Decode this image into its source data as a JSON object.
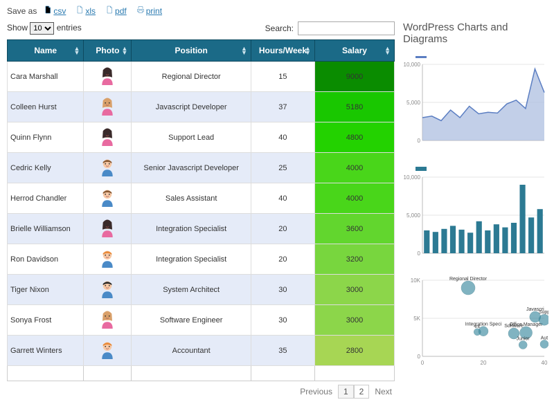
{
  "export": {
    "save_as": "Save as",
    "csv": "csv",
    "xls": "xls",
    "pdf": "pdf",
    "print": "print"
  },
  "controls": {
    "show": "Show",
    "entries": "entries",
    "per_page": "10",
    "search_label": "Search:",
    "search_value": ""
  },
  "columns": {
    "name": "Name",
    "photo": "Photo",
    "position": "Position",
    "hours": "Hours/Week",
    "salary": "Salary"
  },
  "rows": [
    {
      "name": "Cara Marshall",
      "position": "Regional Director",
      "hours": "15",
      "salary": "9000",
      "avatar": "f-dark",
      "sal_color": "#0a8c00"
    },
    {
      "name": "Colleen Hurst",
      "position": "Javascript Developer",
      "hours": "37",
      "salary": "5180",
      "avatar": "f-tan",
      "sal_color": "#19c700"
    },
    {
      "name": "Quinn Flynn",
      "position": "Support Lead",
      "hours": "40",
      "salary": "4800",
      "avatar": "f-dark",
      "sal_color": "#23d200"
    },
    {
      "name": "Cedric Kelly",
      "position": "Senior Javascript Developer",
      "hours": "25",
      "salary": "4000",
      "avatar": "m-brown",
      "sal_color": "#49d61a"
    },
    {
      "name": "Herrod Chandler",
      "position": "Sales Assistant",
      "hours": "40",
      "salary": "4000",
      "avatar": "m-brown",
      "sal_color": "#49d61a"
    },
    {
      "name": "Brielle Williamson",
      "position": "Integration Specialist",
      "hours": "20",
      "salary": "3600",
      "avatar": "f-dark",
      "sal_color": "#62d62e"
    },
    {
      "name": "Ron Davidson",
      "position": "Integration Specialist",
      "hours": "20",
      "salary": "3200",
      "avatar": "m-orange",
      "sal_color": "#78d63e"
    },
    {
      "name": "Tiger Nixon",
      "position": "System Architect",
      "hours": "30",
      "salary": "3000",
      "avatar": "m-dark",
      "sal_color": "#8cd64a"
    },
    {
      "name": "Sonya Frost",
      "position": "Software Engineer",
      "hours": "30",
      "salary": "3000",
      "avatar": "f-tan",
      "sal_color": "#8cd64a"
    },
    {
      "name": "Garrett Winters",
      "position": "Accountant",
      "hours": "35",
      "salary": "2800",
      "avatar": "m-orange",
      "sal_color": "#a7d654"
    }
  ],
  "pager": {
    "previous": "Previous",
    "next": "Next",
    "pages": [
      "1",
      "2"
    ],
    "current": "1"
  },
  "right_title": "WordPress Charts and Diagrams",
  "chart_data": [
    {
      "type": "area",
      "yticks": [
        "0",
        "5,000",
        "10,000"
      ],
      "ylim": [
        0,
        10000
      ],
      "values": [
        3000,
        3200,
        2600,
        4000,
        3000,
        4500,
        3500,
        3700,
        3600,
        4800,
        5300,
        4200,
        9400,
        6300
      ]
    },
    {
      "type": "bar",
      "yticks": [
        "0",
        "5,000",
        "10,000"
      ],
      "ylim": [
        0,
        10000
      ],
      "values": [
        3000,
        2800,
        3200,
        3600,
        3100,
        2700,
        4200,
        3000,
        3800,
        3400,
        4000,
        9000,
        4700,
        5800
      ]
    },
    {
      "type": "scatter",
      "yticks": [
        "0",
        "5K",
        "10K"
      ],
      "xticks": [
        "0",
        "20",
        "40"
      ],
      "xlim": [
        0,
        40
      ],
      "ylim": [
        0,
        10000
      ],
      "points": [
        {
          "x": 15,
          "y": 9000,
          "r": 10,
          "label": "Regional Director"
        },
        {
          "x": 20,
          "y": 3300,
          "r": 7,
          "label": "Integration Speci"
        },
        {
          "x": 30,
          "y": 3000,
          "r": 8,
          "label": "Software"
        },
        {
          "x": 34,
          "y": 3100,
          "r": 9,
          "label": "Office Manager"
        },
        {
          "x": 37,
          "y": 5180,
          "r": 8,
          "label": "Javascri"
        },
        {
          "x": 40,
          "y": 4800,
          "r": 8,
          "label": "Supp"
        },
        {
          "x": 33,
          "y": 1500,
          "r": 6,
          "label": "Junior"
        },
        {
          "x": 40,
          "y": 1600,
          "r": 6,
          "label": "Aut"
        },
        {
          "x": 18,
          "y": 3200,
          "r": 5,
          "label": "Int"
        }
      ]
    }
  ]
}
